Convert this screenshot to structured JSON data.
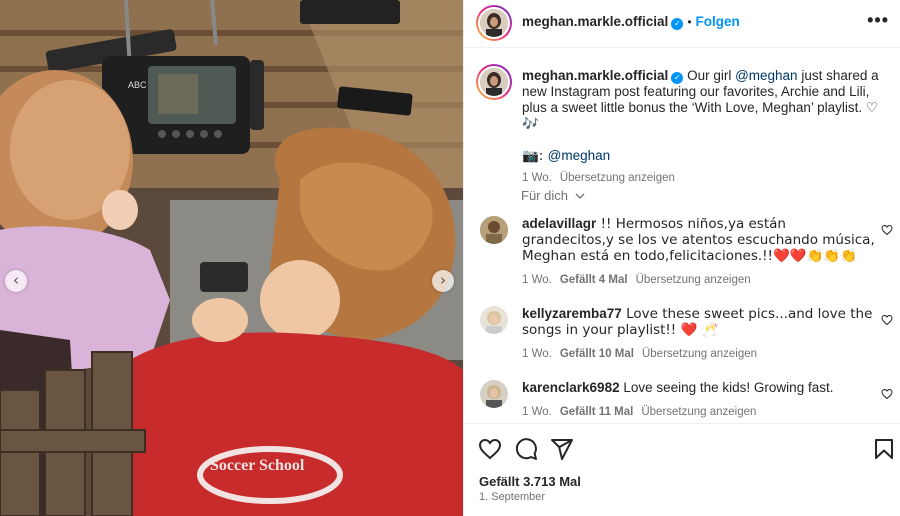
{
  "post": {
    "username": "meghan.markle.official",
    "follow_label": "Folgen",
    "separator": "•",
    "more_label": "•••"
  },
  "caption": {
    "username": "meghan.markle.official",
    "text_pre": " Our girl ",
    "mention1": "@meghan",
    "text_post": " just shared a new Instagram post featuring our favorites, Archie and Lili, plus a sweet little bonus the ‘With Love, Meghan’ playlist. ♡ 🎶",
    "camera_prefix": "📷: ",
    "mention2": "@meghan",
    "time": "1 Wo.",
    "translate": "Übersetzung anzeigen"
  },
  "for_you": "Für dich",
  "comments": [
    {
      "username": "adelavillagr",
      "text": " !! Hermosos niños,ya están grandecitos,y se los ve atentos escuchando música, Meghan está en todo,felicitaciones.!!❤️❤️👏👏👏",
      "time": "1 Wo.",
      "likes": "Gefällt 4 Mal",
      "translate": "Übersetzung anzeigen"
    },
    {
      "username": "kellyzaremba77",
      "text": " Love these sweet pics...and love the songs in your playlist!! ❤️ 🥂",
      "time": "1 Wo.",
      "likes": "Gefällt 10 Mal",
      "translate": "Übersetzung anzeigen"
    },
    {
      "username": "karenclark6982",
      "text": " Love seeing the kids! Growing fast.",
      "time": "1 Wo.",
      "likes": "Gefällt 11 Mal",
      "translate": "Übersetzung anzeigen"
    }
  ],
  "footer": {
    "likes": "Gefällt 3.713 Mal",
    "date": "1. September"
  },
  "photo": {
    "device_label": "ABC",
    "shirt_text": "Soccer School"
  },
  "icons": {
    "verified": "verified-badge",
    "like": "heart-outline-icon",
    "comment": "speech-bubble-icon",
    "share": "paper-plane-icon",
    "save": "bookmark-icon",
    "prev": "chevron-left-icon",
    "next": "chevron-right-icon"
  },
  "colors": {
    "accent": "#0095f6",
    "mention": "#00376b",
    "meta": "#737373"
  }
}
